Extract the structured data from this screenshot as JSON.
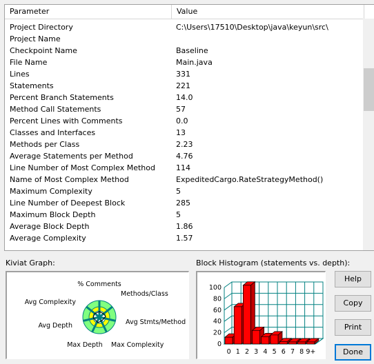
{
  "table": {
    "headers": {
      "parameter": "Parameter",
      "value": "Value"
    },
    "rows": [
      {
        "parameter": "Project Directory",
        "value": "C:\\Users\\17510\\Desktop\\java\\keyun\\src\\"
      },
      {
        "parameter": "Project Name",
        "value": ""
      },
      {
        "parameter": "Checkpoint Name",
        "value": "Baseline"
      },
      {
        "parameter": "File Name",
        "value": "Main.java"
      },
      {
        "parameter": "Lines",
        "value": "331"
      },
      {
        "parameter": "Statements",
        "value": "221"
      },
      {
        "parameter": "Percent Branch Statements",
        "value": "14.0"
      },
      {
        "parameter": "Method Call Statements",
        "value": "57"
      },
      {
        "parameter": "Percent Lines with Comments",
        "value": "0.0"
      },
      {
        "parameter": "Classes and Interfaces",
        "value": "13"
      },
      {
        "parameter": "Methods per Class",
        "value": "2.23"
      },
      {
        "parameter": "Average Statements per Method",
        "value": "4.76"
      },
      {
        "parameter": "Line Number of Most Complex Method",
        "value": "114"
      },
      {
        "parameter": "Name of Most Complex Method",
        "value": "ExpeditedCargo.RateStrategyMethod()"
      },
      {
        "parameter": "Maximum Complexity",
        "value": "5"
      },
      {
        "parameter": "Line Number of Deepest Block",
        "value": "285"
      },
      {
        "parameter": "Maximum Block Depth",
        "value": "5"
      },
      {
        "parameter": "Average Block Depth",
        "value": "1.86"
      },
      {
        "parameter": "Average Complexity",
        "value": "1.57"
      }
    ]
  },
  "kiviat": {
    "label": "Kiviat Graph:",
    "axes": [
      "% Comments",
      "Methods/Class",
      "Avg Stmts/Method",
      "Max Complexity",
      "Max Depth",
      "Avg Depth",
      "Avg Complexity"
    ],
    "colors": {
      "band": "#80ff80",
      "outline": "#008080",
      "ring": "#ffff00"
    }
  },
  "histogram": {
    "label": "Block Histogram (statements vs. depth):",
    "colors": {
      "bar": "#ff0000",
      "grid": "#008080"
    },
    "chart_data": {
      "type": "bar",
      "categories": [
        "0",
        "1",
        "2",
        "3",
        "4",
        "5",
        "6",
        "7",
        "8",
        "9+"
      ],
      "values": [
        12,
        66,
        104,
        24,
        13,
        16,
        4,
        0,
        0,
        0
      ],
      "ylim": [
        0,
        100
      ],
      "yticks": [
        "0",
        "20",
        "40",
        "60",
        "80",
        "100"
      ]
    }
  },
  "buttons": {
    "help": "Help",
    "copy": "Copy",
    "print": "Print",
    "done": "Done"
  }
}
